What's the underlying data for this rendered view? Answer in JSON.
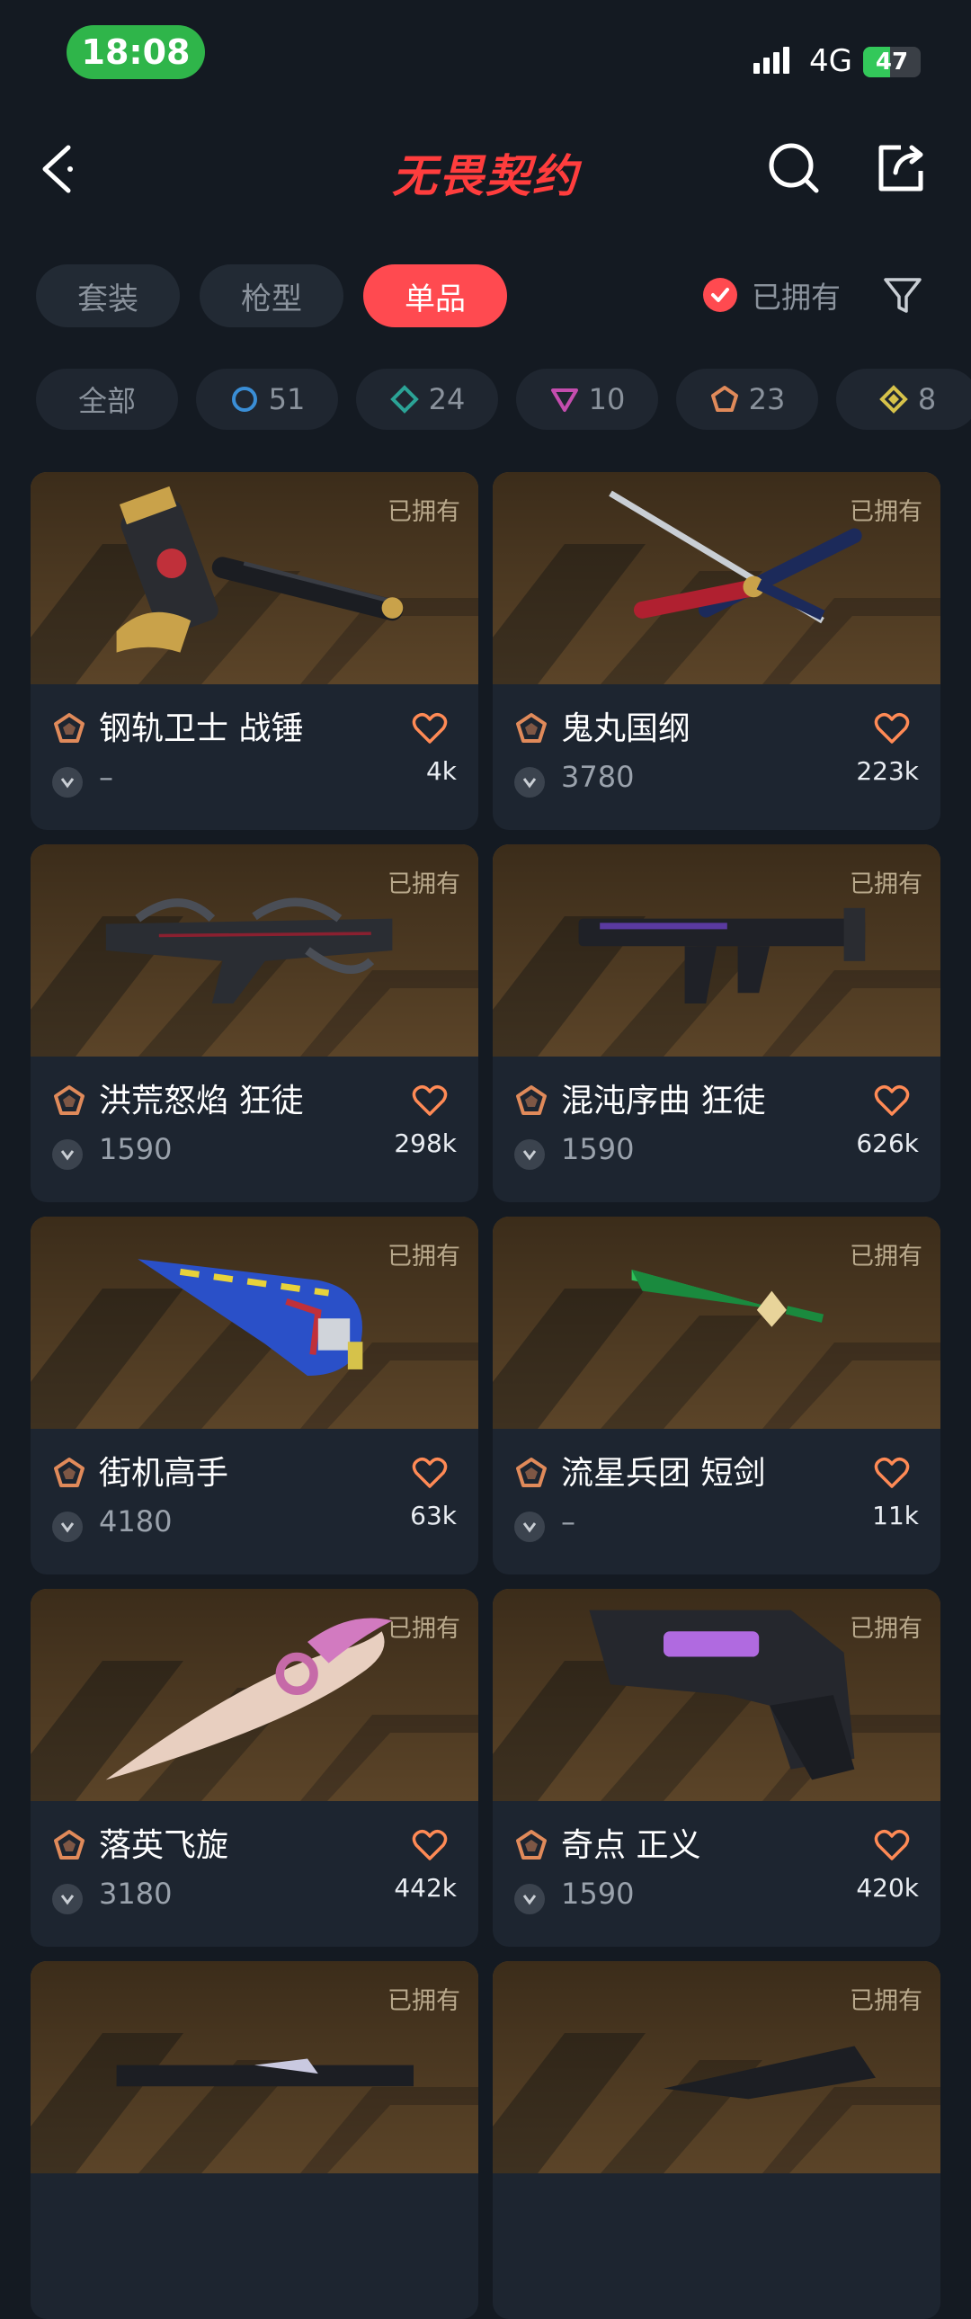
{
  "status_bar": {
    "time": "18:08",
    "network": "4G",
    "battery": "47",
    "battery_level": 0.47
  },
  "header": {
    "title": "无畏契约"
  },
  "colors": {
    "accent": "#ff4a50",
    "page_bg": "#141a22",
    "card_bg": "#1d2530",
    "thumb_bg": "#5a4428",
    "tier_icon": "#e08a5a",
    "heart": "#ff8a55"
  },
  "tabs": [
    {
      "label": "套装",
      "active": false
    },
    {
      "label": "枪型",
      "active": false
    },
    {
      "label": "单品",
      "active": true
    }
  ],
  "owned_filter": {
    "label": "已拥有",
    "checked": true
  },
  "tier_filters": [
    {
      "label": "全部",
      "icon": null
    },
    {
      "label": "51",
      "icon": "select-tier-icon",
      "color": "#3a8ed6"
    },
    {
      "label": "24",
      "icon": "deluxe-tier-icon",
      "color": "#2ba396"
    },
    {
      "label": "10",
      "icon": "premium-tier-icon",
      "color": "#c44dae"
    },
    {
      "label": "23",
      "icon": "exclusive-tier-icon",
      "color": "#e08a5a"
    },
    {
      "label": "8",
      "icon": "ultra-tier-icon",
      "color": "#d6c24a"
    }
  ],
  "items": [
    {
      "name": "钢轨卫士 战锤",
      "price": "–",
      "likes": "4k",
      "owned": "已拥有",
      "weapon": "hammer"
    },
    {
      "name": "鬼丸国纲",
      "price": "3780",
      "likes": "223k",
      "owned": "已拥有",
      "weapon": "katana"
    },
    {
      "name": "洪荒怒焰 狂徒",
      "price": "1590",
      "likes": "298k",
      "owned": "已拥有",
      "weapon": "rifle-spiky"
    },
    {
      "name": "混沌序曲 狂徒",
      "price": "1590",
      "likes": "626k",
      "owned": "已拥有",
      "weapon": "rifle-dark"
    },
    {
      "name": "街机高手",
      "price": "4180",
      "likes": "63k",
      "owned": "已拥有",
      "weapon": "blue-blade"
    },
    {
      "name": "流星兵团 短剑",
      "price": "–",
      "likes": "11k",
      "owned": "已拥有",
      "weapon": "green-dagger"
    },
    {
      "name": "落英飞旋",
      "price": "3180",
      "likes": "442k",
      "owned": "已拥有",
      "weapon": "pink-knife"
    },
    {
      "name": "奇点 正义",
      "price": "1590",
      "likes": "420k",
      "owned": "已拥有",
      "weapon": "revolver"
    },
    {
      "name": "",
      "price": "",
      "likes": "",
      "owned": "已拥有",
      "weapon": "dark-gun-a"
    },
    {
      "name": "",
      "price": "",
      "likes": "",
      "owned": "已拥有",
      "weapon": "dark-gun-b"
    }
  ]
}
